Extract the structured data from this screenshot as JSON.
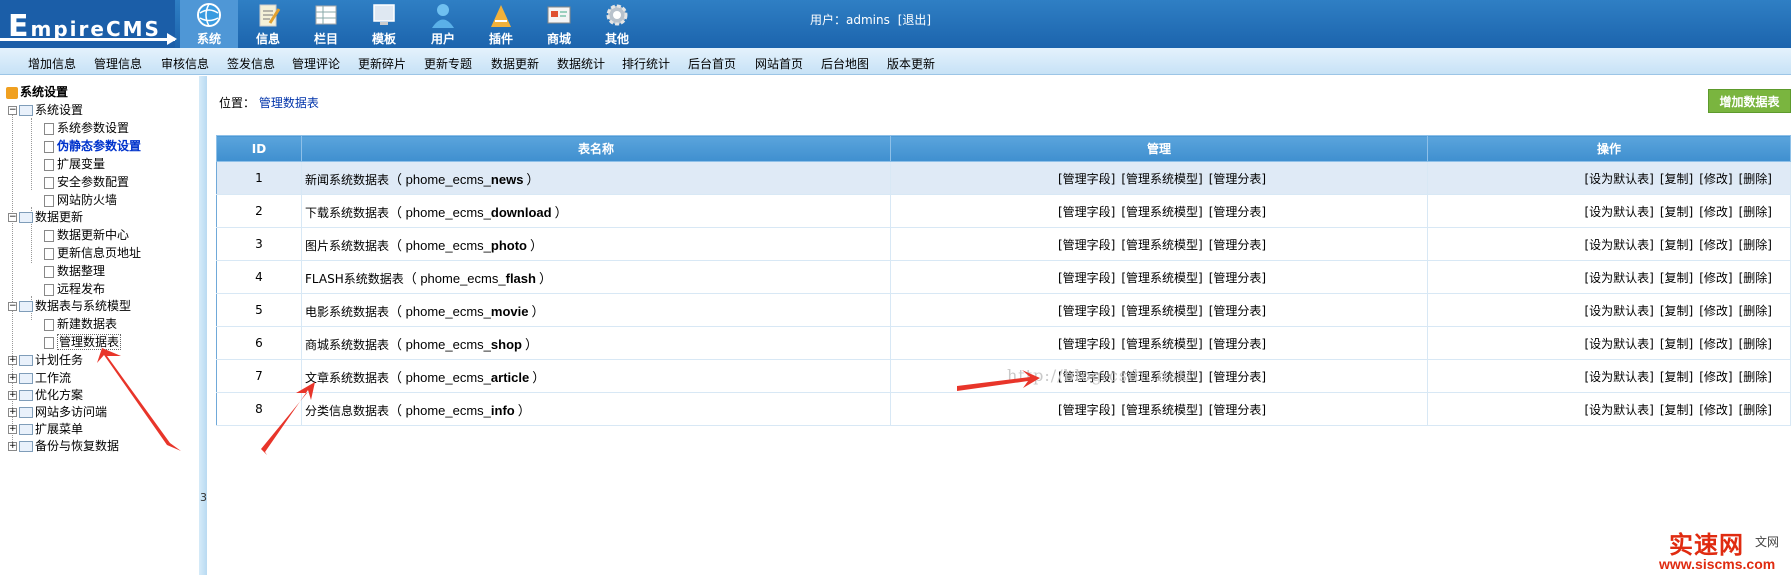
{
  "header": {
    "logo_big": "E",
    "logo_rest": "mpireCMS",
    "user_label": "用户：",
    "username": "admins",
    "logout": "[退出]",
    "nav": [
      {
        "label": "系统",
        "icon": "system-globe-icon",
        "active": true
      },
      {
        "label": "信息",
        "icon": "info-notepad-icon",
        "active": false
      },
      {
        "label": "栏目",
        "icon": "column-grid-icon",
        "active": false
      },
      {
        "label": "模板",
        "icon": "template-monitor-icon",
        "active": false
      },
      {
        "label": "用户",
        "icon": "user-person-icon",
        "active": false
      },
      {
        "label": "插件",
        "icon": "plugin-tools-icon",
        "active": false
      },
      {
        "label": "商城",
        "icon": "shop-card-icon",
        "active": false
      },
      {
        "label": "其他",
        "icon": "other-gear-icon",
        "active": false
      }
    ]
  },
  "submenu": [
    "增加信息",
    "管理信息",
    "审核信息",
    "签发信息",
    "管理评论",
    "更新碎片",
    "更新专题",
    "数据更新",
    "数据统计",
    "排行统计",
    "后台首页",
    "网站首页",
    "后台地图",
    "版本更新"
  ],
  "sidebar": {
    "root": "系统设置",
    "groups": [
      {
        "label": "系统设置",
        "expanded": true,
        "children": [
          "系统参数设置",
          "伪静态参数设置",
          "扩展变量",
          "安全参数配置",
          "网站防火墙"
        ]
      },
      {
        "label": "数据更新",
        "expanded": true,
        "children": [
          "数据更新中心",
          "更新信息页地址",
          "数据整理",
          "远程发布"
        ]
      },
      {
        "label": "数据表与系统模型",
        "expanded": true,
        "children": [
          "新建数据表",
          "管理数据表"
        ]
      },
      {
        "label": "计划任务",
        "expanded": false,
        "children": []
      },
      {
        "label": "工作流",
        "expanded": false,
        "children": []
      },
      {
        "label": "优化方案",
        "expanded": false,
        "children": []
      },
      {
        "label": "网站多访问端",
        "expanded": false,
        "children": []
      },
      {
        "label": "扩展菜单",
        "expanded": false,
        "children": []
      },
      {
        "label": "备份与恢复数据",
        "expanded": false,
        "children": []
      }
    ],
    "splitter_label": "3"
  },
  "main": {
    "location_label": "位置：",
    "location_link": "管理数据表",
    "add_button": "增加数据表",
    "columns": [
      "ID",
      "表名称",
      "管理",
      "操作"
    ],
    "manage_actions": [
      "[管理字段]",
      "[管理系统模型]",
      "[管理分表]"
    ],
    "op_actions": [
      "[设为默认表]",
      "[复制]",
      "[修改]",
      "[删除]"
    ],
    "rows": [
      {
        "id": "1",
        "name": "新闻系统数据表",
        "open": "（ phome_ecms_",
        "table": "news",
        "close": "）"
      },
      {
        "id": "2",
        "name": "下载系统数据表",
        "open": "（ phome_ecms_",
        "table": "download",
        "close": "）"
      },
      {
        "id": "3",
        "name": "图片系统数据表",
        "open": "（ phome_ecms_",
        "table": "photo",
        "close": "）"
      },
      {
        "id": "4",
        "name": "FLASH系统数据表",
        "open": "（ phome_ecms_",
        "table": "flash",
        "close": "）"
      },
      {
        "id": "5",
        "name": "电影系统数据表",
        "open": "（ phome_ecms_",
        "table": "movie",
        "close": "）"
      },
      {
        "id": "6",
        "name": "商城系统数据表",
        "open": "（ phome_ecms_",
        "table": "shop",
        "close": "）"
      },
      {
        "id": "7",
        "name": "文章系统数据表",
        "open": "（ phome_ecms_",
        "table": "article",
        "close": "）"
      },
      {
        "id": "8",
        "name": "分类信息数据表",
        "open": "（ phome_ecms_",
        "table": "info",
        "close": "）"
      }
    ],
    "watermark": "http://blog.csdn.net/"
  },
  "site_logo": {
    "brand": "实速网",
    "suffix": "文网",
    "url": "www.siscms.com"
  },
  "colors": {
    "header": "#1c64ad",
    "submenu": "#c7e2f6",
    "table_head": "#3f8fcf",
    "add_button": "#7ab53f",
    "arrow": "#e8352a",
    "link": "#0033aa"
  }
}
